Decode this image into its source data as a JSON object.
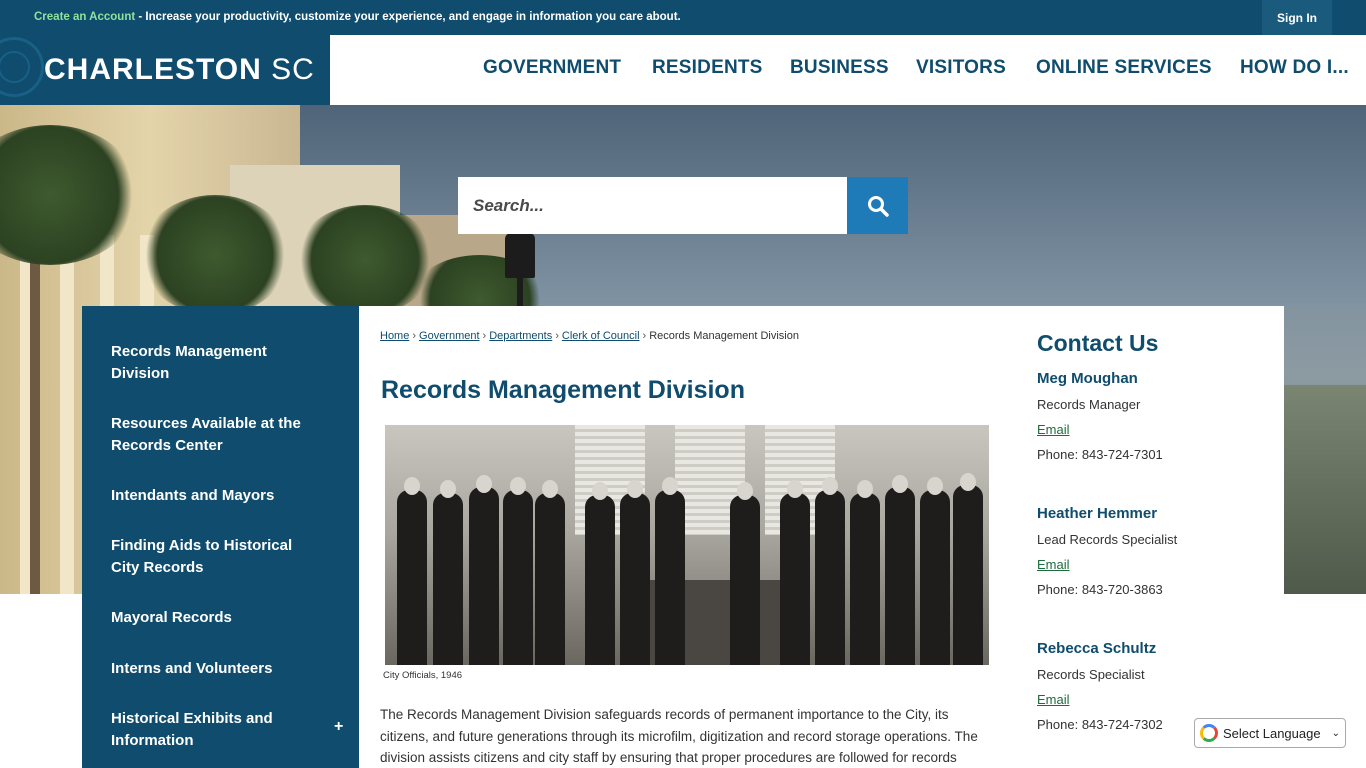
{
  "topbar": {
    "create_account": "Create an Account",
    "message": " - Increase your productivity, customize your experience, and engage in information you care about.",
    "sign_in": "Sign In"
  },
  "logo": {
    "bold": "CHARLESTON",
    "light": " SC"
  },
  "nav": [
    "GOVERNMENT",
    "RESIDENTS",
    "BUSINESS",
    "VISITORS",
    "ONLINE SERVICES",
    "HOW DO I..."
  ],
  "search": {
    "placeholder": "Search..."
  },
  "sidebar": {
    "items": [
      "Records Management Division",
      "Resources Available at the Records Center",
      "Intendants and Mayors",
      "Finding Aids to Historical City Records",
      "Mayoral Records",
      "Interns and Volunteers",
      "Historical Exhibits and Information"
    ],
    "expand_symbol": "+"
  },
  "breadcrumb": {
    "items": [
      "Home",
      "Government",
      "Departments",
      "Clerk of Council"
    ],
    "current": "Records Management Division",
    "separator": "›"
  },
  "page": {
    "title": "Records Management Division",
    "photo_caption": "City Officials, 1946",
    "body": "The Records Management Division safeguards records of permanent importance to the City, its citizens, and future generations through its microfilm, digitization and record storage operations. The division assists citizens and city staff by ensuring that proper procedures are followed for records"
  },
  "contact": {
    "title": "Contact Us",
    "people": [
      {
        "name": "Meg Moughan",
        "role": "Records Manager",
        "email": "Email",
        "phone": "Phone: 843-724-7301"
      },
      {
        "name": "Heather Hemmer",
        "role": "Lead Records Specialist",
        "email": "Email",
        "phone": "Phone: 843-720-3863"
      },
      {
        "name": "Rebecca Schultz",
        "role": "Records Specialist",
        "email": "Email",
        "phone": "Phone: 843-724-7302"
      }
    ]
  },
  "translate": {
    "label": "Select Language",
    "arrow": "⌄"
  },
  "colors": {
    "brand": "#0f4c6d",
    "accent": "#1f7ab8",
    "account_link": "#8fe39b"
  }
}
